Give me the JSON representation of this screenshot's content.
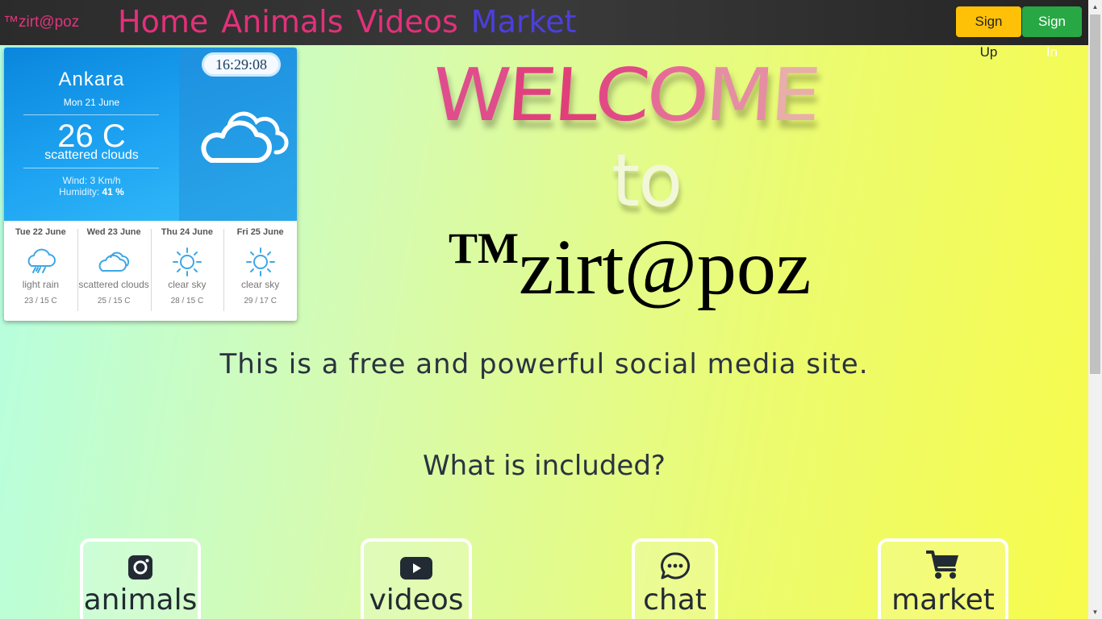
{
  "navbar": {
    "brand": "™zirt@poz",
    "links": [
      "Home",
      "Animals",
      "Videos",
      "Market"
    ],
    "signup_label": "Sign Up",
    "signin_label": "Sign In",
    "colors": {
      "link": "#e3307a",
      "market_link": "#4b3fe0",
      "signup": "#ffc107",
      "signin": "#28a745"
    }
  },
  "weather": {
    "city": "Ankara",
    "date": "Mon 21 June",
    "temperature": "26 C",
    "description": "scattered clouds",
    "wind": "Wind: 3 Km/h",
    "humidity_label": "Humidity:",
    "humidity_value": "41 %",
    "clock": "16:29:08",
    "icon": "cloud-icon",
    "forecast": [
      {
        "date": "Tue 22 June",
        "icon": "rain-cloud-icon",
        "desc": "light rain",
        "range": "23 / 15 C"
      },
      {
        "date": "Wed 23 June",
        "icon": "cloud-icon",
        "desc": "scattered clouds",
        "range": "25 / 15 C"
      },
      {
        "date": "Thu 24 June",
        "icon": "sun-icon",
        "desc": "clear sky",
        "range": "28 / 15 C"
      },
      {
        "date": "Fri 25 June",
        "icon": "sun-icon",
        "desc": "clear sky",
        "range": "29 / 17 C"
      }
    ]
  },
  "hero": {
    "welcome": "WELCOME",
    "to": "to",
    "brand_tm": "TM",
    "brand_name": "zirt@poz",
    "tagline": "This is a free and powerful social media site.",
    "included_heading": "What is included?"
  },
  "features": [
    {
      "label": "animals",
      "icon": "instagram-icon"
    },
    {
      "label": "videos",
      "icon": "youtube-icon"
    },
    {
      "label": "chat",
      "icon": "chat-bubble-icon"
    },
    {
      "label": "market",
      "icon": "shopping-cart-icon"
    }
  ]
}
